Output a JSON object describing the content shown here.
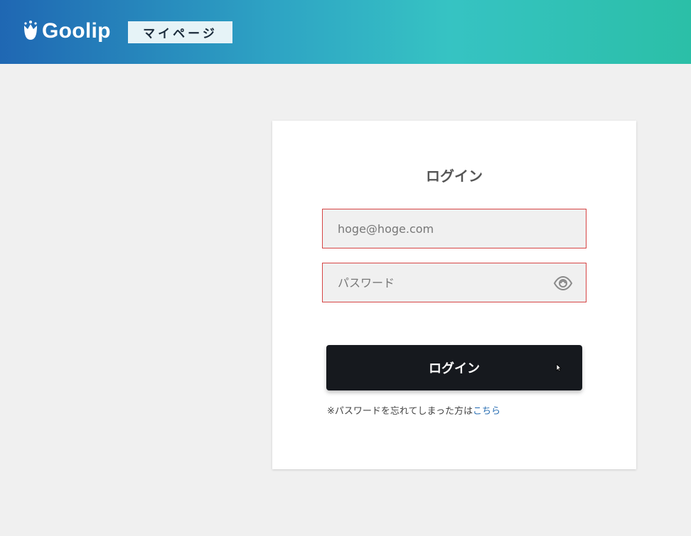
{
  "header": {
    "logo_text": "Goolip",
    "badge_label": "マイページ"
  },
  "login": {
    "title": "ログイン",
    "email_placeholder": "hoge@hoge.com",
    "password_placeholder": "パスワード",
    "submit_label": "ログイン",
    "forgot_text": "※パスワードを忘れてしまった方は",
    "forgot_link": "こちら"
  },
  "icons": {
    "logo": "tulip-icon",
    "password_toggle": "eye-icon",
    "cursor": "pointer-cursor-icon"
  },
  "colors": {
    "header_gradient_start": "#1f67b3",
    "header_gradient_end": "#2bbfa7",
    "field_border": "#d64545",
    "button_bg": "#16191e",
    "link": "#2a6fb3"
  }
}
